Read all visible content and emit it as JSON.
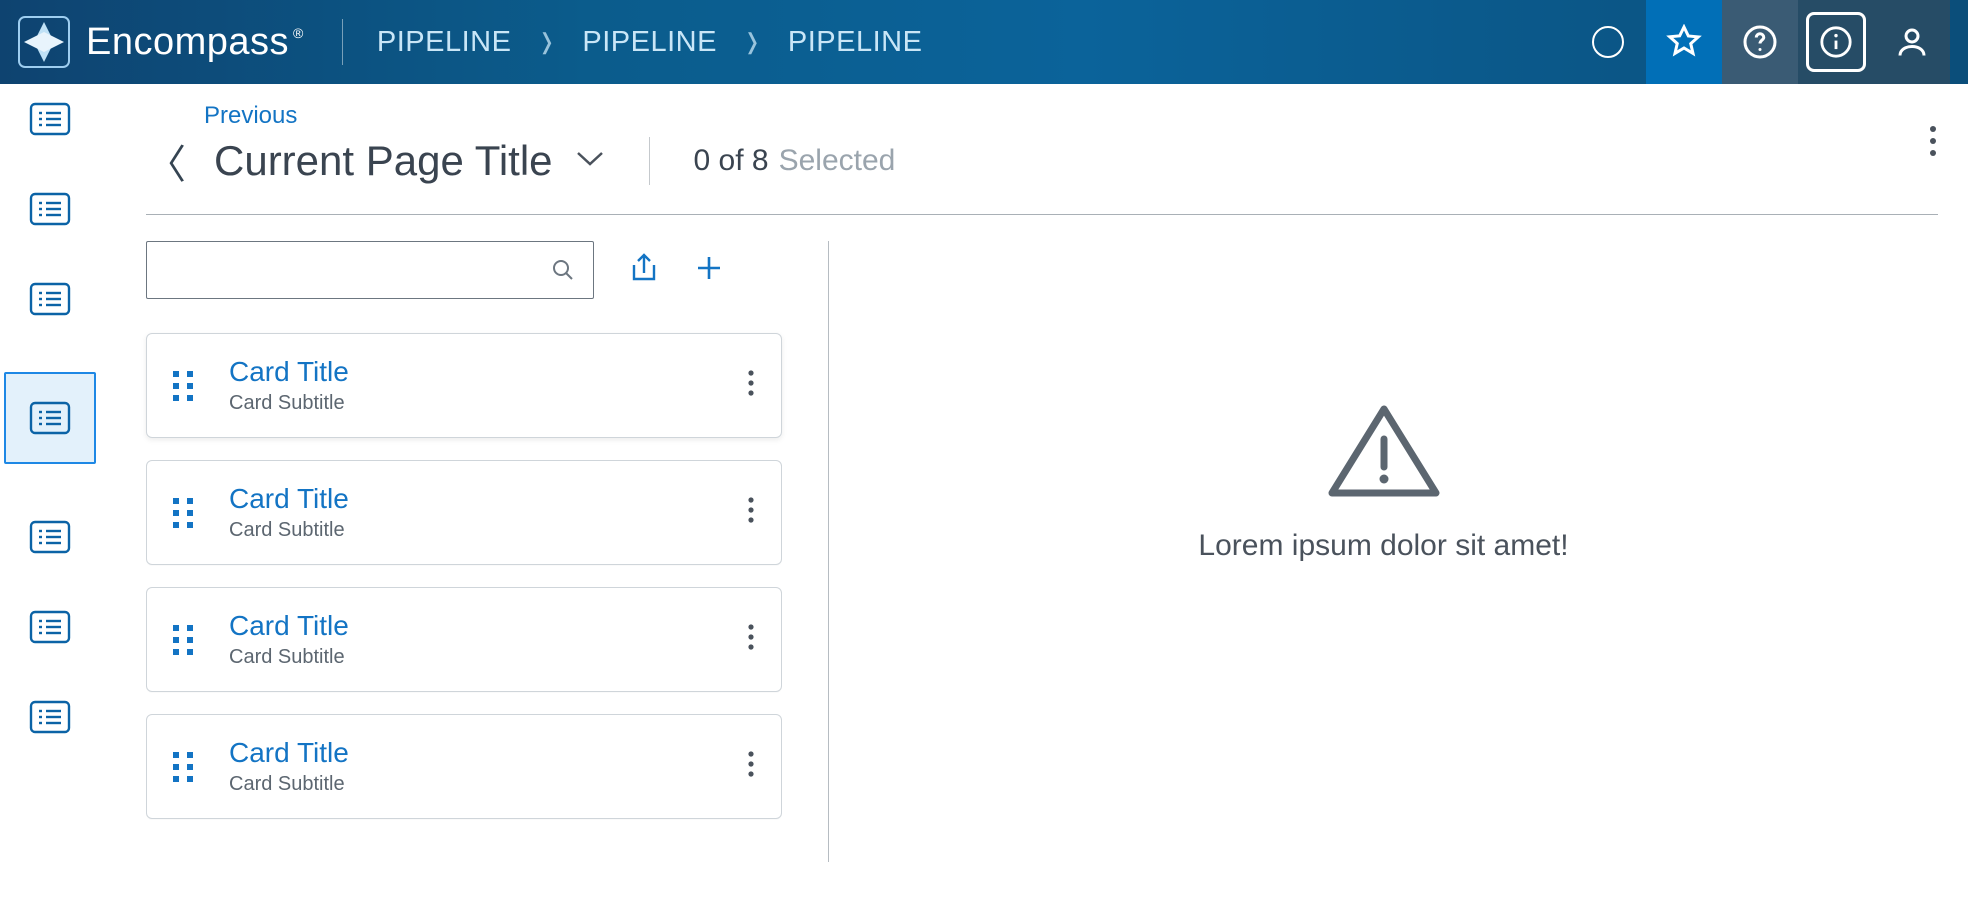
{
  "header": {
    "product_name": "Encompass",
    "trademark": "®",
    "breadcrumbs": [
      "PIPELINE",
      "PIPELINE",
      "PIPELINE"
    ]
  },
  "page": {
    "previous_label": "Previous",
    "title": "Current Page Title",
    "count_text": "0 of 8",
    "count_label": "Selected"
  },
  "search": {
    "value": "",
    "placeholder": ""
  },
  "cards": [
    {
      "title": "Card Title",
      "subtitle": "Card Subtitle"
    },
    {
      "title": "Card Title",
      "subtitle": "Card Subtitle"
    },
    {
      "title": "Card Title",
      "subtitle": "Card Subtitle"
    },
    {
      "title": "Card Title",
      "subtitle": "Card Subtitle"
    }
  ],
  "detail": {
    "message": "Lorem ipsum dolor sit amet!"
  },
  "colors": {
    "brand_blue": "#1374c4",
    "topbar_start": "#0e4370",
    "topbar_end": "#0b4e7a"
  }
}
